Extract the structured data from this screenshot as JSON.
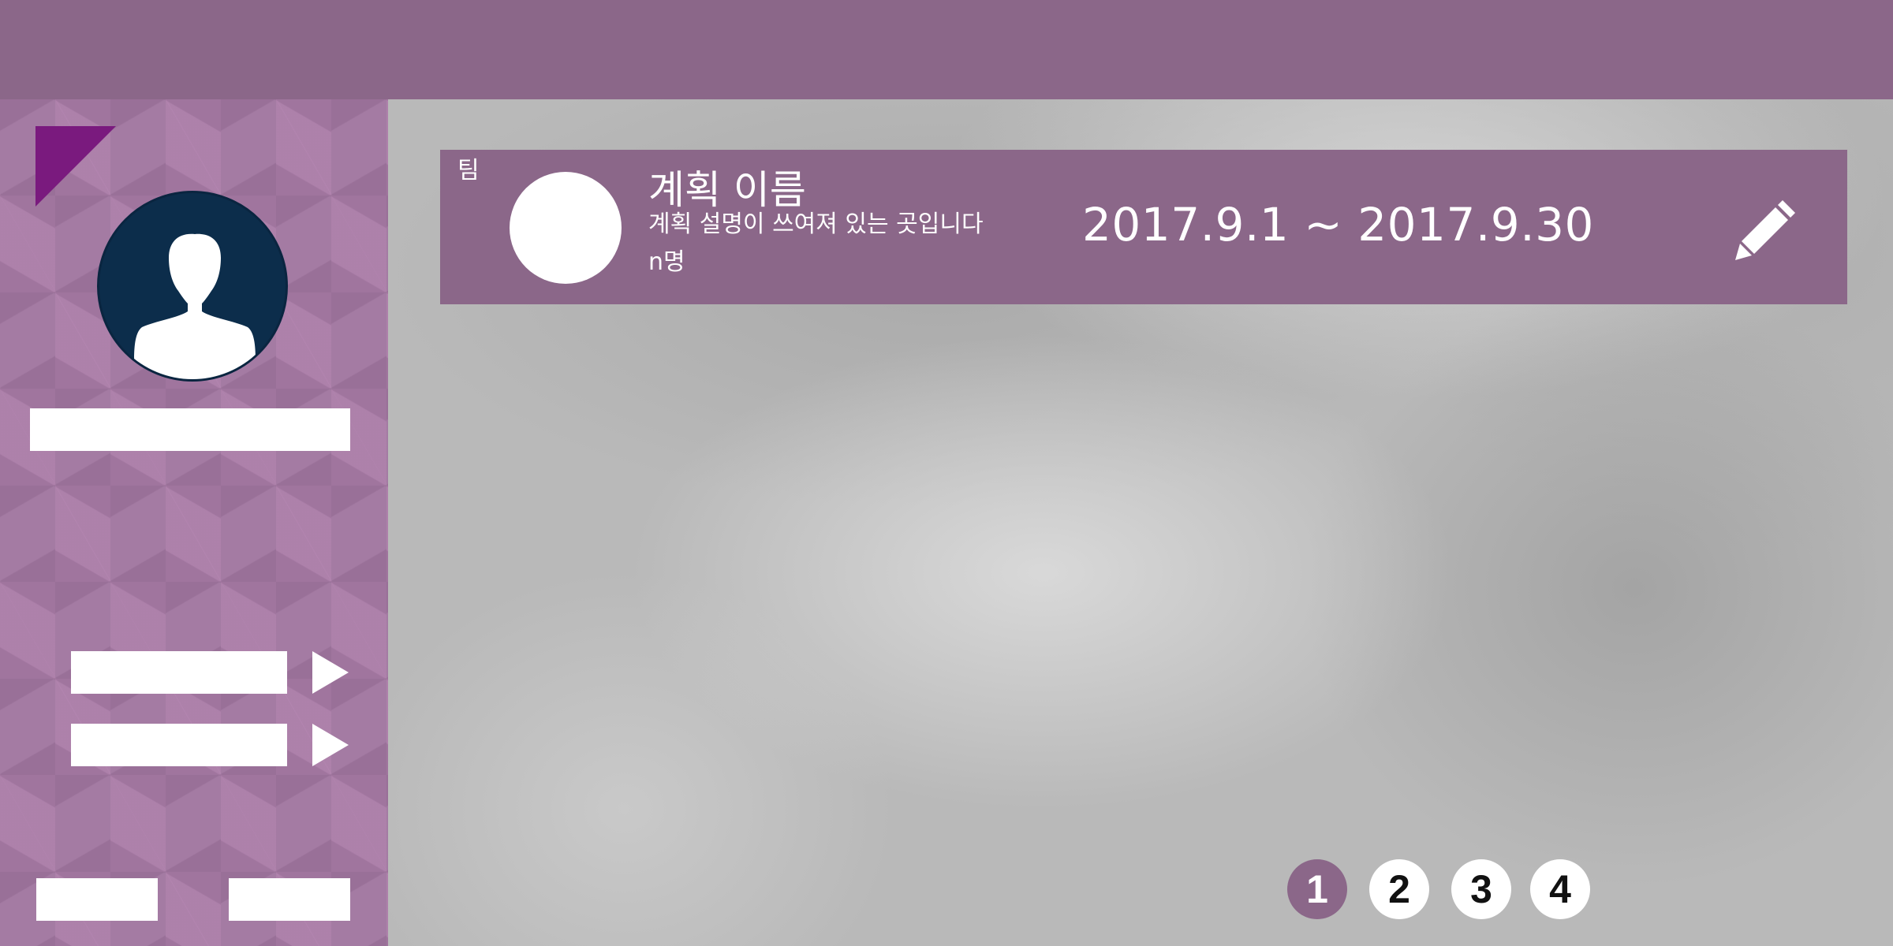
{
  "plan": {
    "team_label": "팀",
    "name": "계획 이름",
    "description": "계획 설명이 쓰여져 있는 곳입니다",
    "members": "n명",
    "dates": "2017.9.1 ~ 2017.9.30"
  },
  "pagination": {
    "pages": [
      "1",
      "2",
      "3",
      "4"
    ],
    "active_page": "1"
  },
  "colors": {
    "brand_purple": "#8b6789",
    "corner_flag": "#7a1a7e",
    "avatar_bg": "#0c2d4b"
  },
  "icons": {
    "edit": "pencil-icon",
    "avatar": "user-silhouette-icon",
    "menu_arrow": "play-arrow-icon"
  }
}
